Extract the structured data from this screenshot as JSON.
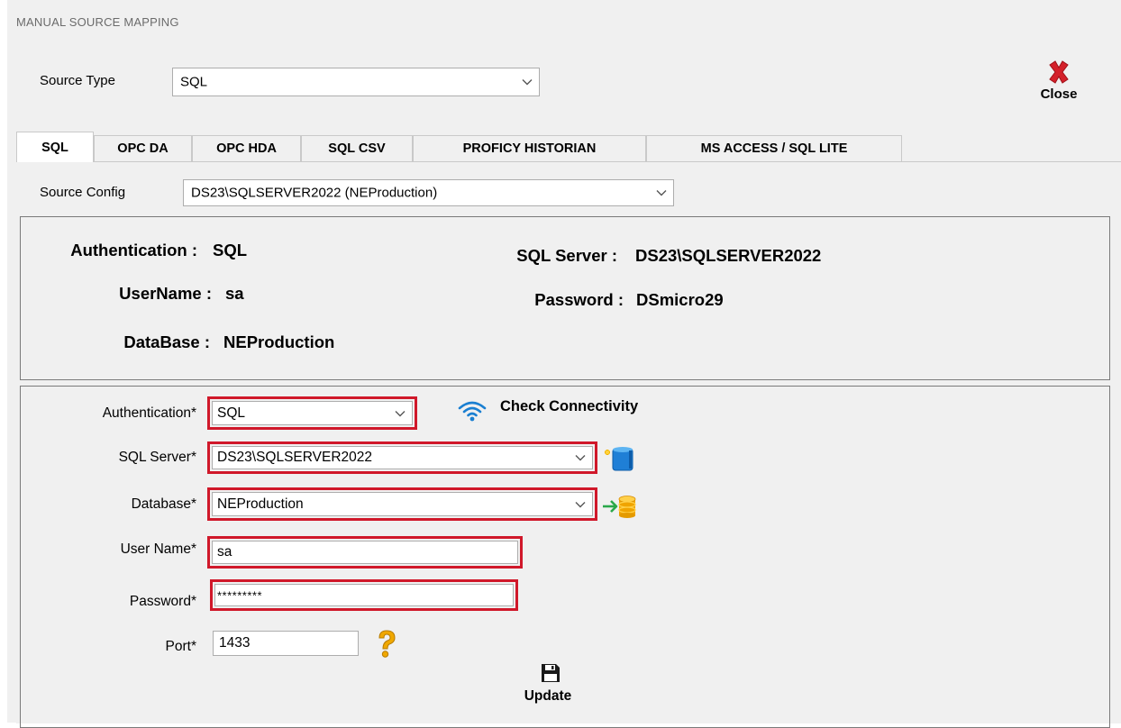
{
  "window": {
    "title": "MANUAL SOURCE MAPPING"
  },
  "source_type": {
    "label": "Source Type",
    "value": "SQL"
  },
  "close_button": {
    "label": "Close"
  },
  "tabs": [
    {
      "label": "SQL",
      "active": true
    },
    {
      "label": "OPC DA"
    },
    {
      "label": "OPC HDA"
    },
    {
      "label": "SQL CSV"
    },
    {
      "label": "PROFICY HISTORIAN"
    },
    {
      "label": "MS ACCESS / SQL LITE"
    }
  ],
  "source_config": {
    "label": "Source Config",
    "value": "DS23\\SQLSERVER2022 (NEProduction)"
  },
  "summary": {
    "authentication_label": "Authentication :",
    "authentication_value": "SQL",
    "sql_server_label": "SQL Server :",
    "sql_server_value": "DS23\\SQLSERVER2022",
    "username_label": "UserName :",
    "username_value": "sa",
    "password_label": "Password :",
    "password_value": "DSmicro29",
    "database_label": "DataBase :",
    "database_value": "NEProduction"
  },
  "form": {
    "authentication_label": "Authentication*",
    "authentication_value": "SQL",
    "check_connectivity_label": "Check Connectivity",
    "sql_server_label": "SQL Server*",
    "sql_server_value": "DS23\\SQLSERVER2022",
    "database_label": "Database*",
    "database_value": "NEProduction",
    "username_label": "User Name*",
    "username_value": "sa",
    "password_label": "Password*",
    "password_value": "*********",
    "port_label": "Port*",
    "port_value": "1433",
    "update_label": "Update"
  },
  "colors": {
    "highlight_border": "#d0182a",
    "close_x": "#d4202a",
    "wifi": "#1a7fd1",
    "help": "#f0a800"
  },
  "icons": [
    "close-x-icon",
    "wifi-icon",
    "server-database-icon",
    "database-arrow-icon",
    "help-question-icon",
    "floppy-disk-icon",
    "chevron-down-icon"
  ]
}
